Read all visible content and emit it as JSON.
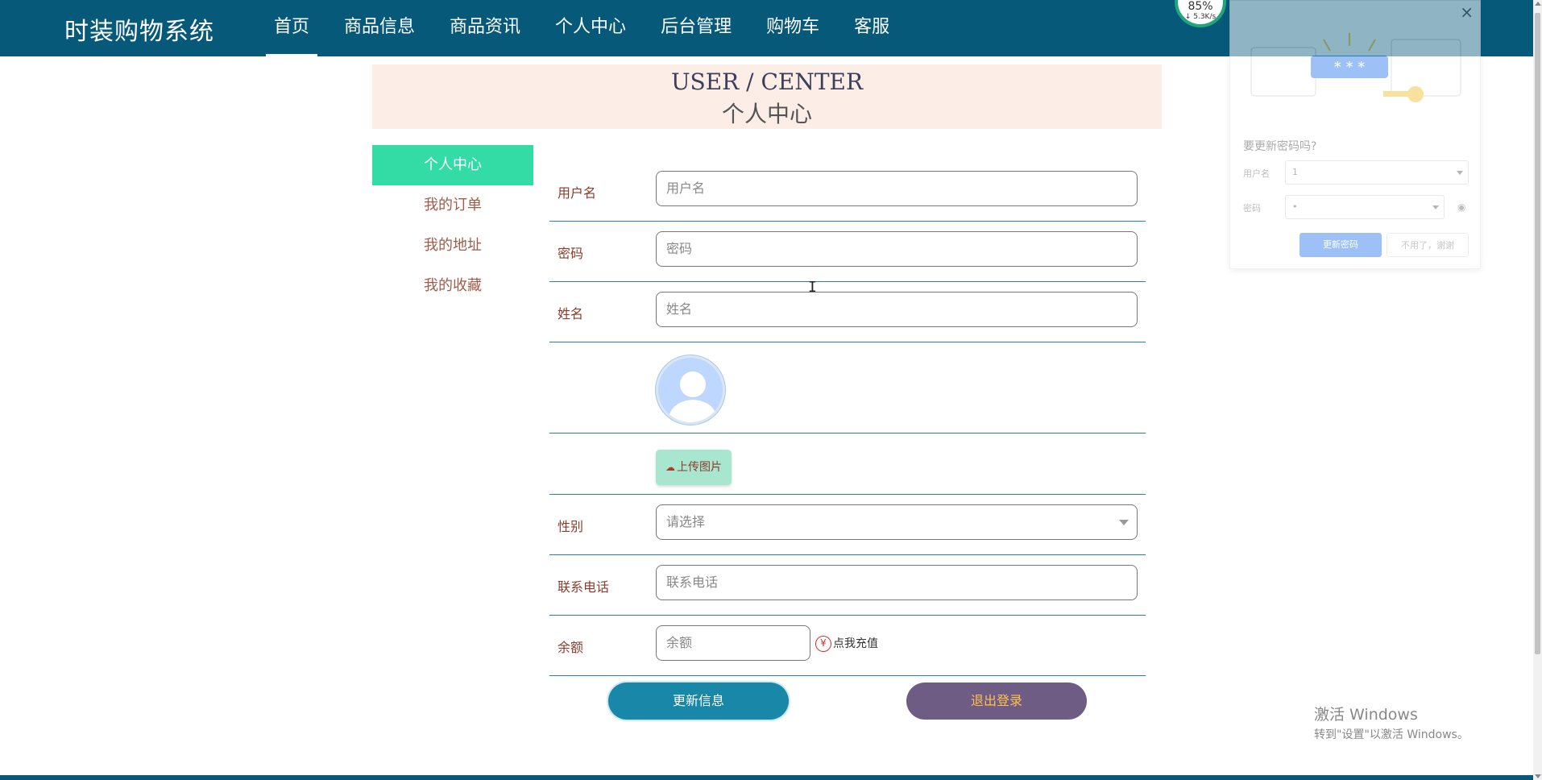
{
  "header": {
    "brand": "时装购物系统",
    "nav": [
      "首页",
      "商品信息",
      "商品资讯",
      "个人中心",
      "后台管理",
      "购物车",
      "客服"
    ],
    "active_nav": "首页",
    "speed_percent": "85%",
    "speed_rate": "↓ 5.3K/s"
  },
  "banner": {
    "title_en": "USER / CENTER",
    "title_cn": "个人中心"
  },
  "sidebar": {
    "items": [
      "个人中心",
      "我的订单",
      "我的地址",
      "我的收藏"
    ],
    "active": "个人中心"
  },
  "form": {
    "username": {
      "label": "用户名",
      "placeholder": "用户名"
    },
    "password": {
      "label": "密码",
      "placeholder": "密码"
    },
    "name": {
      "label": "姓名",
      "placeholder": "姓名"
    },
    "upload_label": "上传图片",
    "gender": {
      "label": "性别",
      "placeholder": "请选择"
    },
    "phone": {
      "label": "联系电话",
      "placeholder": "联系电话"
    },
    "balance": {
      "label": "余额",
      "placeholder": "余额"
    },
    "recharge_icon": "¥",
    "recharge_label": "点我充值"
  },
  "actions": {
    "update": "更新信息",
    "logout": "退出登录"
  },
  "password_popup": {
    "question": "要更新密码吗?",
    "username_label": "用户名",
    "username_value": "1",
    "password_label": "密码",
    "password_value": "•",
    "update_button": "更新密码",
    "decline_button": "不用了，谢谢",
    "illustration_text": "* * *"
  },
  "windows_notice": {
    "title": "激活 Windows",
    "subtitle": "转到\"设置\"以激活 Windows。"
  },
  "colors": {
    "header_bg": "#07597a",
    "sidebar_active": "#33dca5",
    "update_button": "#1887a8",
    "logout_button": "#6e5c84"
  }
}
